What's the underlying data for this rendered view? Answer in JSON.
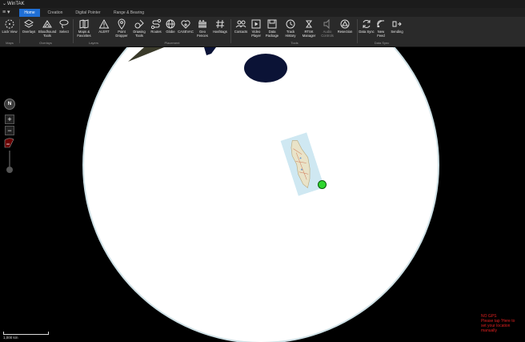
{
  "window": {
    "title": "WinTAK",
    "collapse_glyph": "⌄"
  },
  "menu": {
    "glyph": "≡ ▾"
  },
  "tabs": [
    {
      "label": "Home",
      "active": true
    },
    {
      "label": "Creation"
    },
    {
      "label": "Digital Pointer"
    },
    {
      "label": "Range & Bearing"
    }
  ],
  "ribbon": {
    "lock_view": "Lock View",
    "overlays": "Overlays",
    "bloodhound": "Bloodhound Tools",
    "select": "Select",
    "maps_favorites": "Maps & Favorites",
    "alert": "ALERT",
    "point_dropper": "Point Dropper",
    "drawing_tools": "Drawing Tools",
    "routes": "Routes",
    "globe": "Globe",
    "casevac": "CASEVAC",
    "geo_fences": "Geo Fences",
    "hashtags": "Hashtags",
    "contacts": "Contacts",
    "video_player": "Video Player",
    "data_package": "Data Package",
    "track_history": "Track History",
    "rtsk_manager": "RTSK Manager",
    "audio_controls": "Audio Controls",
    "resection": "Resection",
    "data_sync": "Data Sync",
    "new_feed": "New Feed",
    "sending": "Sending"
  },
  "groups": {
    "maps": "Maps",
    "overlays": "Overlays",
    "layers": "Layers",
    "placement": "Placement",
    "tools": "Tools",
    "data_sync": "Data Sync"
  },
  "map": {
    "compass_label": "N",
    "zoom_in": "+",
    "zoom_out": "−",
    "scale_label": "1,000 km",
    "gps_warning": [
      "NO GPS",
      "Please tap 'Here to",
      "set your location",
      "manually"
    ],
    "globe_color": "#ffffff",
    "water_color": "#0b1336",
    "gps_dot_color": "#2fd62f",
    "accent": "#1f6fd6"
  }
}
